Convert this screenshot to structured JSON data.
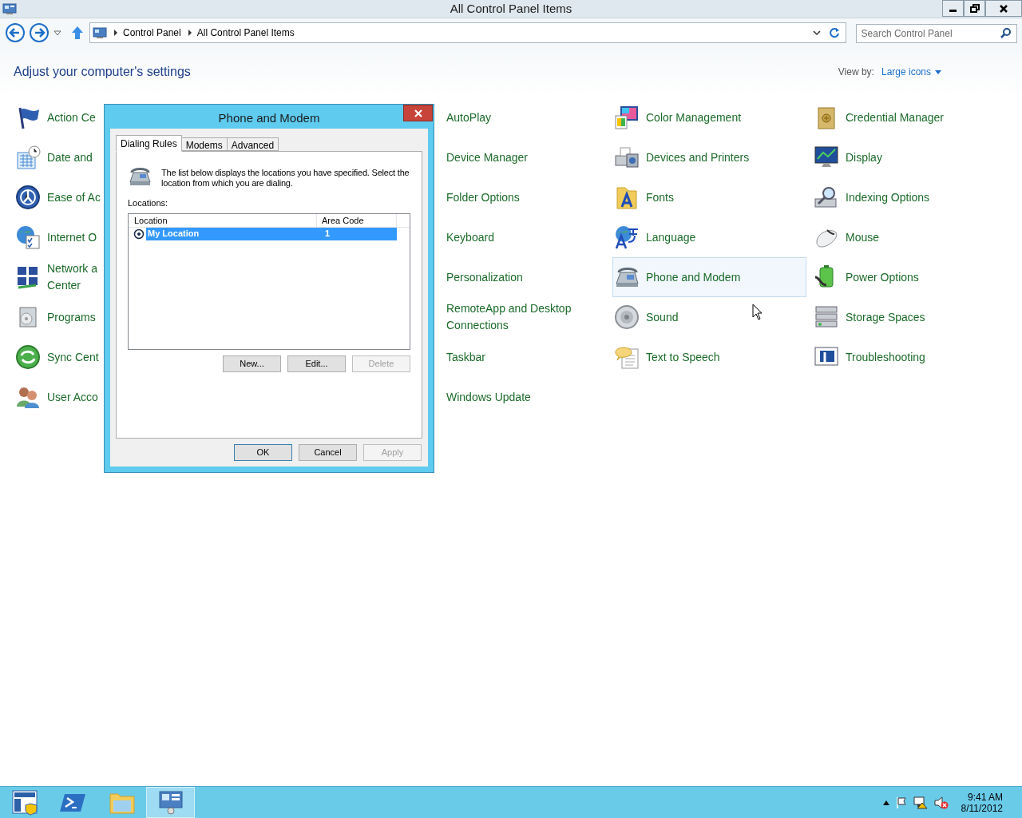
{
  "window": {
    "title": "All Control Panel Items"
  },
  "address_bar": {
    "crumbs": [
      "Control Panel",
      "All Control Panel Items"
    ]
  },
  "search": {
    "placeholder": "Search Control Panel"
  },
  "heading": "Adjust your computer's settings",
  "view_by": {
    "label": "View by:",
    "value": "Large icons"
  },
  "columns": [
    [
      {
        "label": "Action Ce",
        "hovered": false
      },
      {
        "label": "Date and ",
        "hovered": false
      },
      {
        "label": "Ease of Ac",
        "hovered": false
      },
      {
        "label": "Internet O",
        "hovered": false
      },
      {
        "label": "Network a\nCenter",
        "hovered": false
      },
      {
        "label": "Programs",
        "hovered": false
      },
      {
        "label": "Sync Cent",
        "hovered": false
      },
      {
        "label": "User Acco",
        "hovered": false
      }
    ],
    [
      {
        "label": "AutoPlay",
        "hovered": false
      },
      {
        "label": "Device Manager",
        "hovered": false
      },
      {
        "label": "Folder Options",
        "hovered": false
      },
      {
        "label": "Keyboard",
        "hovered": false
      },
      {
        "label": "Personalization",
        "hovered": false
      },
      {
        "label": "RemoteApp and Desktop\nConnections",
        "hovered": false
      },
      {
        "label": "Taskbar",
        "hovered": false
      },
      {
        "label": "Windows Update",
        "hovered": false
      }
    ],
    [
      {
        "label": "Color Management",
        "hovered": false
      },
      {
        "label": "Devices and Printers",
        "hovered": false
      },
      {
        "label": "Fonts",
        "hovered": false
      },
      {
        "label": "Language",
        "hovered": false
      },
      {
        "label": "Phone and Modem",
        "hovered": true
      },
      {
        "label": "Sound",
        "hovered": false
      },
      {
        "label": "Text to Speech",
        "hovered": false
      }
    ],
    [
      {
        "label": "Credential Manager",
        "hovered": false
      },
      {
        "label": "Display",
        "hovered": false
      },
      {
        "label": "Indexing Options",
        "hovered": false
      },
      {
        "label": "Mouse",
        "hovered": false
      },
      {
        "label": "Power Options",
        "hovered": false
      },
      {
        "label": "Storage Spaces",
        "hovered": false
      },
      {
        "label": "Troubleshooting",
        "hovered": false
      }
    ]
  ],
  "dialog": {
    "title": "Phone and Modem",
    "tabs": [
      {
        "label": "Dialing Rules",
        "selected": true
      },
      {
        "label": "Modems",
        "selected": false
      },
      {
        "label": "Advanced",
        "selected": false
      }
    ],
    "description": "The list below displays the locations you have specified. Select the location from which you are dialing.",
    "list_label": "Locations:",
    "list_columns": [
      "Location",
      "Area Code"
    ],
    "rows": [
      {
        "location": "My Location",
        "area_code": "1",
        "selected": true
      }
    ],
    "list_buttons": [
      {
        "label": "New...",
        "disabled": false
      },
      {
        "label": "Edit...",
        "disabled": false
      },
      {
        "label": "Delete",
        "disabled": true
      }
    ],
    "buttons": [
      {
        "label": "OK",
        "disabled": false
      },
      {
        "label": "Cancel",
        "disabled": false
      },
      {
        "label": "Apply",
        "disabled": true
      }
    ]
  },
  "taskbar": {
    "apps": [
      {
        "selected": false
      },
      {
        "selected": false
      },
      {
        "selected": false
      },
      {
        "selected": true
      }
    ],
    "time": "9:41 AM",
    "date": "8/11/2012"
  }
}
